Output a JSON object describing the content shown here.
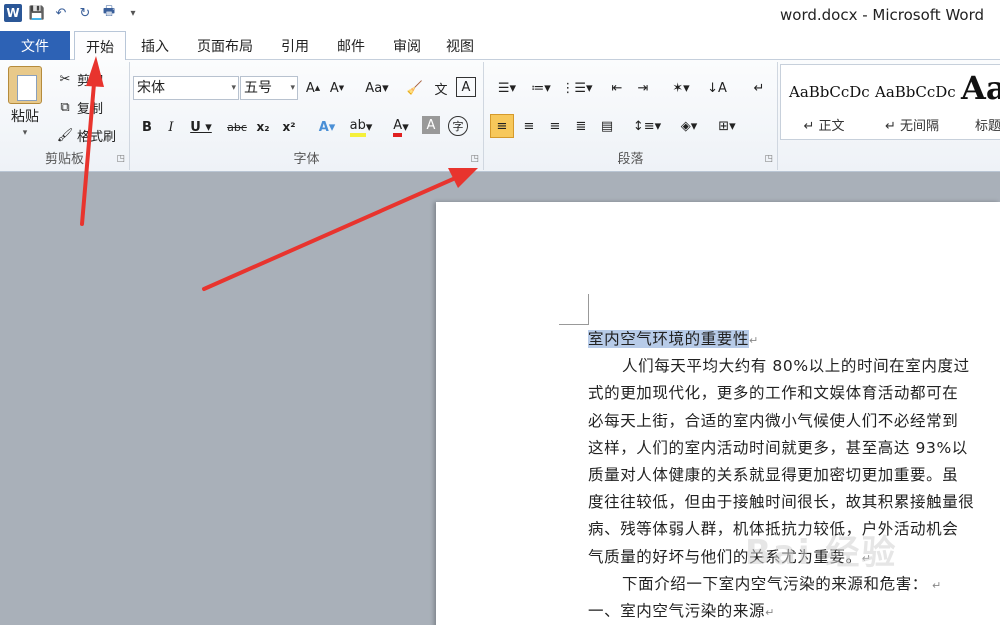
{
  "window": {
    "title": "word.docx - Microsoft Word"
  },
  "tabs": [
    {
      "label": "文件"
    },
    {
      "label": "开始"
    },
    {
      "label": "插入"
    },
    {
      "label": "页面布局"
    },
    {
      "label": "引用"
    },
    {
      "label": "邮件"
    },
    {
      "label": "审阅"
    },
    {
      "label": "视图"
    }
  ],
  "clipboard": {
    "paste": "粘贴",
    "cut": "剪切",
    "copy": "复制",
    "format_painter": "格式刷",
    "label": "剪贴板"
  },
  "font": {
    "name": "宋体",
    "size": "五号",
    "label": "字体"
  },
  "paragraph": {
    "label": "段落"
  },
  "styles": [
    {
      "sample": "AaBbCcDc",
      "name": "↵ 正文"
    },
    {
      "sample": "AaBbCcDc",
      "name": "↵ 无间隔"
    },
    {
      "sample": "Aa",
      "name": "标题"
    }
  ],
  "document": {
    "heading": "室内空气环境的重要性",
    "lines": [
      "人们每天平均大约有 80%以上的时间在室内度过",
      "式的更加现代化，更多的工作和文娱体育活动都可在",
      "必每天上街，合适的室内微小气候使人们不必经常到",
      "这样，人们的室内活动时间就更多，甚至高达 93%以",
      "质量对人体健康的关系就显得更加密切更加重要。虽",
      "度往往较低，但由于接触时间很长，故其积累接触量很",
      "病、残等体弱人群，机体抵抗力较低，户外活动机会",
      "气质量的好坏与他们的关系尤为重要。"
    ],
    "intro": "下面介绍一下室内空气污染的来源和危害：",
    "section": "一、室内空气污染的来源"
  },
  "watermark": "Bai 经验",
  "colors": {
    "file_tab": "#2d62b5",
    "selection": "#b7cbe8",
    "arrow": "#e8342e",
    "align_selected": "#f7c85b"
  }
}
